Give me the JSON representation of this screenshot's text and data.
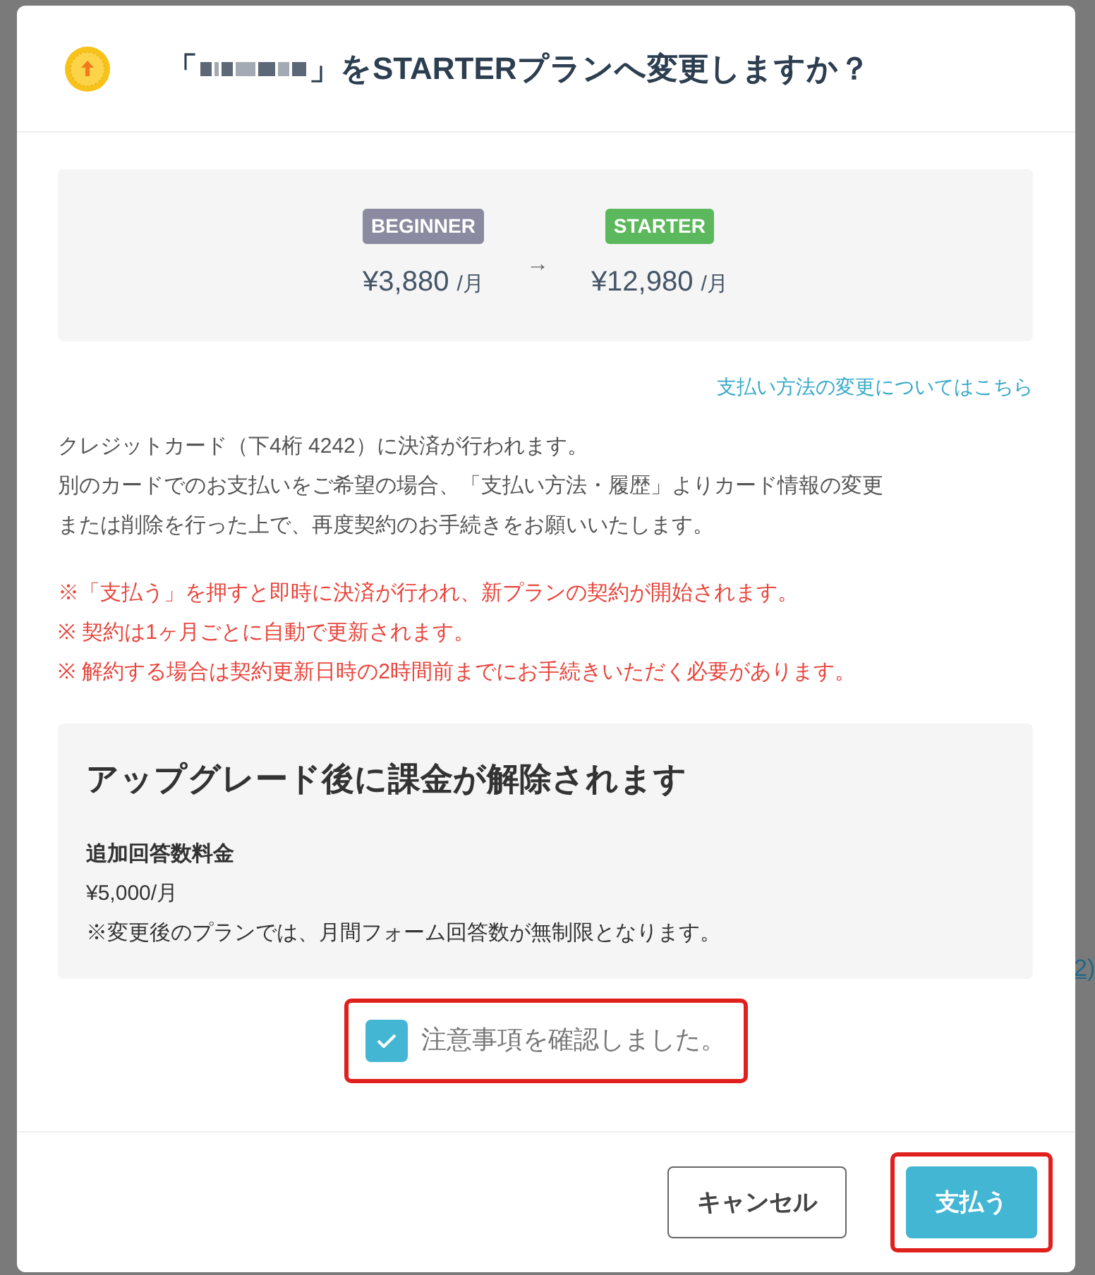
{
  "background": {
    "link_fragment": "2)"
  },
  "dialog": {
    "title_open": "「",
    "title_close": "」をSTARTERプランへ変更しますか？",
    "plans": [
      {
        "badge": "BEGINNER",
        "color": "#8a8aa0",
        "price": "¥3,880",
        "unit": "/月"
      },
      {
        "badge": "STARTER",
        "color": "#5cb85c",
        "price": "¥12,980",
        "unit": "/月"
      }
    ],
    "arrow": "→",
    "payment_link": "支払い方法の変更についてはこちら",
    "notes": [
      "クレジットカード（下4桁 4242）に決済が行われます。",
      "別のカードでのお支払いをご希望の場合、「支払い方法・履歴」よりカード情報の変更",
      "または削除を行った上で、再度契約のお手続きをお願いいたします。"
    ],
    "warnings": [
      "※「支払う」を押すと即時に決済が行われ、新プランの契約が開始されます。",
      "※ 契約は1ヶ月ごとに自動で更新されます。",
      "※ 解約する場合は契約更新日時の2時間前までにお手続きいただく必要があります。"
    ],
    "release": {
      "heading": "アップグレード後に課金が解除されます",
      "item_name": "追加回答数料金",
      "item_price": "¥5,000/月",
      "item_note": "※変更後のプランでは、月間フォーム回答数が無制限となります。"
    },
    "confirm": {
      "label": "注意事項を確認しました。",
      "checked": true,
      "highlighted": true
    },
    "buttons": [
      {
        "label": "キャンセル",
        "kind": "secondary",
        "highlighted": false
      },
      {
        "label": "支払う",
        "kind": "primary",
        "highlighted": true
      }
    ]
  }
}
